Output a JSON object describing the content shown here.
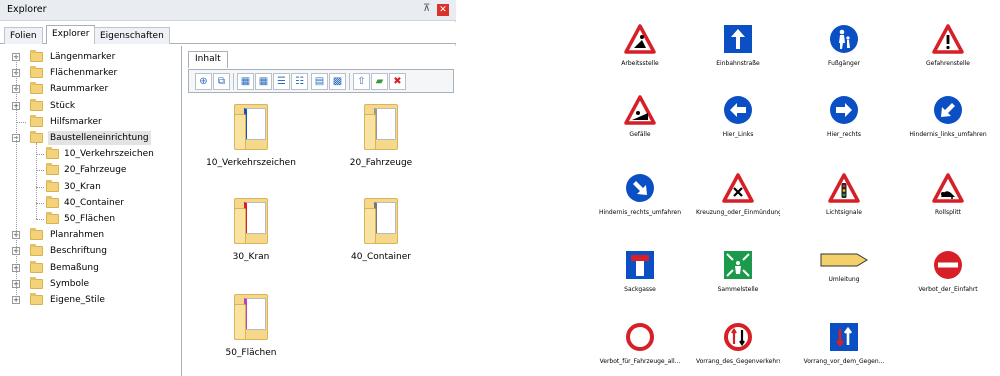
{
  "window": {
    "title": "Explorer",
    "pin_icon": "pin-icon",
    "close_icon": "close-icon"
  },
  "tabs": [
    "Folien",
    "Explorer",
    "Eigenschaften"
  ],
  "active_tab": "Explorer",
  "tree": {
    "items": [
      {
        "label": "Längenmarker",
        "expandable": true
      },
      {
        "label": "Flächenmarker",
        "expandable": true
      },
      {
        "label": "Raummarker",
        "expandable": true
      },
      {
        "label": "Stück",
        "expandable": true
      },
      {
        "label": "Hilfsmarker",
        "expandable": false
      },
      {
        "label": "Baustelleneinrichtung",
        "expandable": true,
        "expanded": true,
        "selected": true,
        "children": [
          "10_Verkehrszeichen",
          "20_Fahrzeuge",
          "30_Kran",
          "40_Container",
          "50_Flächen"
        ]
      },
      {
        "label": "Planrahmen",
        "expandable": true
      },
      {
        "label": "Beschriftung",
        "expandable": true
      },
      {
        "label": "Bemaßung",
        "expandable": true
      },
      {
        "label": "Symbole",
        "expandable": true
      },
      {
        "label": "Eigene_Stile",
        "expandable": true
      }
    ]
  },
  "content": {
    "tab": "Inhalt",
    "toolbar_icons": [
      "new-item-icon",
      "copy-icon",
      "large-icons-view-icon",
      "small-icons-view-icon",
      "list-view-icon",
      "details-view-icon",
      "tiles-view-icon",
      "thumbnail-view-icon",
      "up-arrow-icon",
      "new-folder-icon",
      "delete-icon"
    ],
    "folders": [
      "10_Verkehrszeichen",
      "20_Fahrzeuge",
      "30_Kran",
      "40_Container",
      "50_Flächen"
    ]
  },
  "signs": [
    {
      "label": "Arbeitsstelle",
      "icon": "roadwork-sign-icon"
    },
    {
      "label": "Einbahnstraße",
      "icon": "one-way-sign-icon"
    },
    {
      "label": "Fußgänger",
      "icon": "pedestrian-sign-icon"
    },
    {
      "label": "Gefahrenstelle",
      "icon": "danger-sign-icon"
    },
    {
      "label": "Gefälle",
      "icon": "gradient-sign-icon"
    },
    {
      "label": "Hier_Links",
      "icon": "turn-left-sign-icon"
    },
    {
      "label": "Hier_rechts",
      "icon": "turn-right-sign-icon"
    },
    {
      "label": "Hindernis_links_umfahren",
      "icon": "pass-left-sign-icon"
    },
    {
      "label": "Hindernis_rechts_umfahren",
      "icon": "pass-right-sign-icon"
    },
    {
      "label": "Kreuzung_oder_Einmündung",
      "icon": "crossroads-sign-icon"
    },
    {
      "label": "Lichtsignale",
      "icon": "traffic-lights-sign-icon"
    },
    {
      "label": "Rollsplitt",
      "icon": "loose-chippings-sign-icon"
    },
    {
      "label": "Sackgasse",
      "icon": "dead-end-sign-icon"
    },
    {
      "label": "Sammelstelle",
      "icon": "assembly-point-sign-icon"
    },
    {
      "label": "Umleitung",
      "icon": "detour-sign-icon"
    },
    {
      "label": "Verbot_der_Einfahrt",
      "icon": "no-entry-sign-icon"
    },
    {
      "label": "Verbot_für_Fahrzeuge_all...",
      "icon": "no-vehicles-sign-icon"
    },
    {
      "label": "Vorrang_des_Gegenverkehrs",
      "icon": "yield-oncoming-sign-icon"
    },
    {
      "label": "Vorrang_vor_dem_Gegen...",
      "icon": "priority-oncoming-sign-icon"
    }
  ],
  "colors": {
    "sign_blue": "#0b4fc4",
    "sign_red": "#d61f26",
    "folder_yellow": "#f5d88a",
    "selection": "#e3e3e3"
  }
}
